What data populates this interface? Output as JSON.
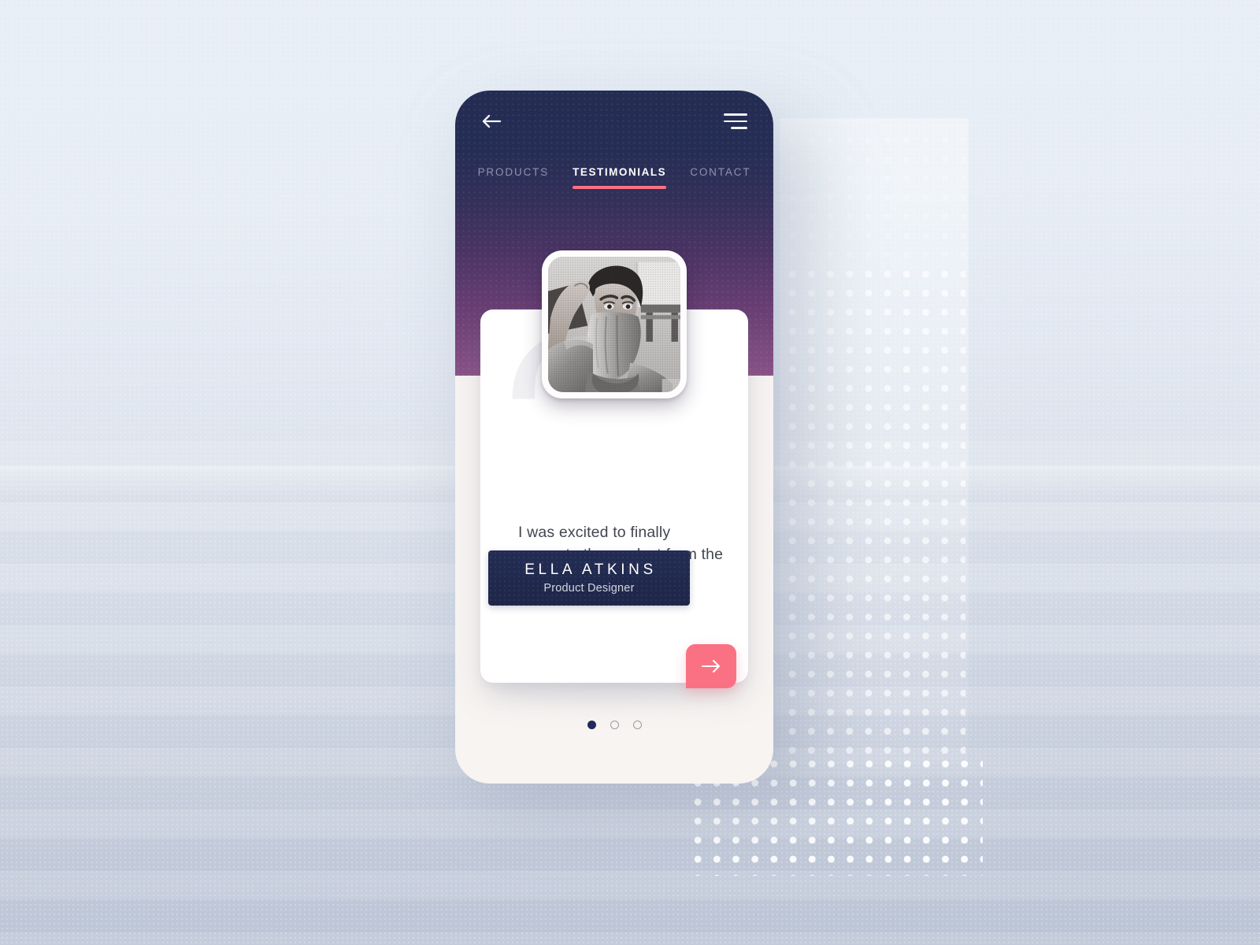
{
  "app": {
    "screen_title": "Testimonials",
    "background_accent": "#fa7184",
    "header_gradient_start": "#232c52",
    "header_gradient_end": "#8a5287",
    "navy": "#232c54"
  },
  "topbar": {
    "back_icon": "arrow-left-icon",
    "menu_icon": "hamburger-menu-icon"
  },
  "tabs": [
    {
      "label": "PRODUCTS",
      "active": false
    },
    {
      "label": "TESTIMONIALS",
      "active": true
    },
    {
      "label": "CONTACT",
      "active": false
    }
  ],
  "testimonial": {
    "avatar_alt": "portrait-photo-woman-covering-face-with-shirt",
    "quote_glyph": "“",
    "quote": "I was excited to finally separate the product from the marketing department.",
    "name": "ELLA ATKINS",
    "role": "Product Designer"
  },
  "controls": {
    "next_icon": "arrow-right-icon",
    "next_label": "Next testimonial"
  },
  "pagination": {
    "dots": [
      {
        "state": "active"
      },
      {
        "state": "inactive"
      },
      {
        "state": "inactive"
      }
    ],
    "current": 1,
    "total": 3
  }
}
